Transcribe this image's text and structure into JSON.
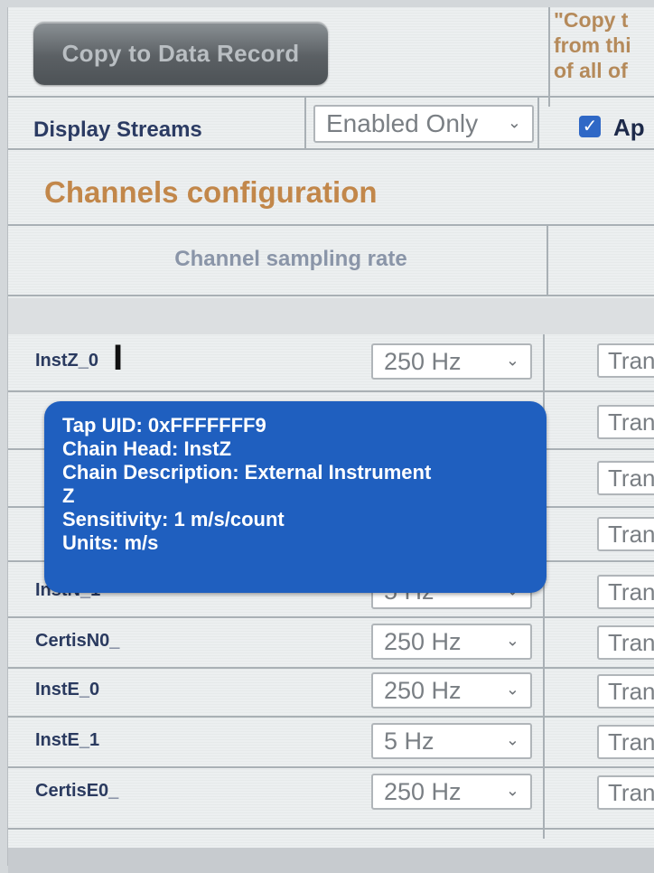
{
  "header": {
    "copy_button": "Copy to Data Record",
    "copy_description_lines": [
      "\"Copy t",
      "from thi",
      "of all of"
    ]
  },
  "display_streams": {
    "label": "Display Streams",
    "selected": "Enabled Only",
    "apply_checked": true,
    "apply_label": "Ap"
  },
  "section_title": "Channels configuration",
  "table": {
    "col_header": "Channel sampling rate",
    "rows": [
      {
        "name": "InstZ_0",
        "rate": "250 Hz",
        "trans": "Tran"
      },
      {
        "name": "",
        "rate": "",
        "trans": "Tran"
      },
      {
        "name": "",
        "rate": "",
        "trans": "Tran"
      },
      {
        "name": "",
        "rate": "",
        "trans": "Tran"
      },
      {
        "name": "InstN_1",
        "rate": "5 Hz",
        "trans": "Tran"
      },
      {
        "name": "CertisN0_",
        "rate": "250 Hz",
        "trans": "Trans"
      },
      {
        "name": "InstE_0",
        "rate": "250 Hz",
        "trans": "Trans"
      },
      {
        "name": "InstE_1",
        "rate": "5 Hz",
        "trans": "Trans"
      },
      {
        "name": "CertisE0_",
        "rate": "250 Hz",
        "trans": "Trans"
      }
    ]
  },
  "tooltip": {
    "line1": "Tap UID: 0xFFFFFFF9",
    "line2": "Chain Head: InstZ",
    "line3": "Chain Description: External Instrument",
    "line4": "Z",
    "line5": "Sensitivity: 1 m/s/count",
    "line6": "Units: m/s"
  },
  "icons": {
    "chevron": "chevron-down-icon",
    "cursor": "text-cursor-icon",
    "checkbox": "checkbox-checked-icon"
  },
  "colors": {
    "tooltip_bg": "#1f5fbf",
    "section_title": "#c2874a",
    "checkbox": "#2f68c6"
  }
}
